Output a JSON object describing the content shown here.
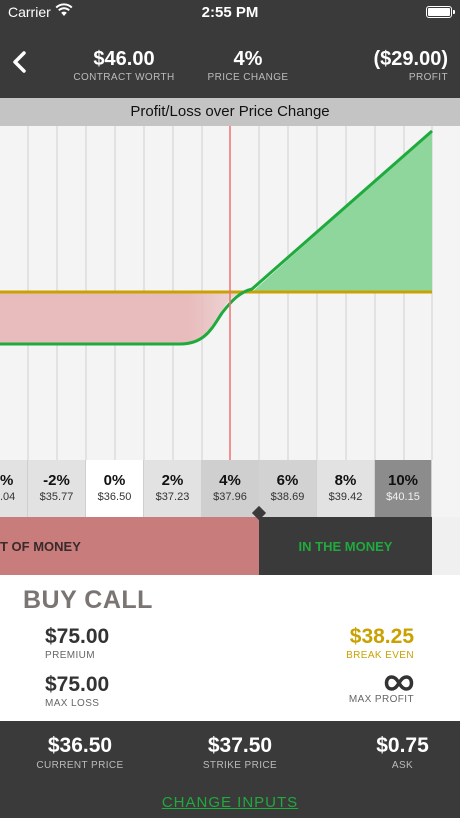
{
  "status_bar": {
    "carrier": "Carrier",
    "time": "2:55 PM"
  },
  "header": {
    "contract_worth": {
      "value": "$46.00",
      "label": "CONTRACT WORTH"
    },
    "price_change": {
      "value": "4%",
      "label": "PRICE CHANGE"
    },
    "profit": {
      "value": "($29.00)",
      "label": "PROFIT"
    }
  },
  "chart": {
    "title": "Profit/Loss over Price Change"
  },
  "scale": [
    {
      "pct": "%",
      "price": ".04"
    },
    {
      "pct": "-2%",
      "price": "$35.77"
    },
    {
      "pct": "0%",
      "price": "$36.50"
    },
    {
      "pct": "2%",
      "price": "$37.23"
    },
    {
      "pct": "4%",
      "price": "$37.96"
    },
    {
      "pct": "6%",
      "price": "$38.69"
    },
    {
      "pct": "8%",
      "price": "$39.42"
    },
    {
      "pct": "10%",
      "price": "$40.15"
    }
  ],
  "money": {
    "out": "T OF MONEY",
    "in": "IN THE MONEY"
  },
  "strategy": {
    "title": "BUY CALL",
    "premium": {
      "value": "$75.00",
      "label": "PREMIUM"
    },
    "max_loss": {
      "value": "$75.00",
      "label": "MAX LOSS"
    },
    "break_even": {
      "value": "$38.25",
      "label": "BREAK EVEN"
    },
    "max_profit": {
      "icon": "infinity-icon",
      "label": "MAX PROFIT"
    }
  },
  "footer": {
    "current_price": {
      "value": "$36.50",
      "label": "CURRENT PRICE"
    },
    "strike_price": {
      "value": "$37.50",
      "label": "STRIKE PRICE"
    },
    "ask": {
      "value": "$0.75",
      "label": "ASK"
    },
    "change_inputs": "CHANGE INPUTS"
  },
  "colors": {
    "dark": "#3a3a3a",
    "profit_green": "#1faa3e",
    "loss_red": "#c97c7c",
    "break_even_gold": "#c9a100",
    "current_marker": "#f07070"
  }
}
